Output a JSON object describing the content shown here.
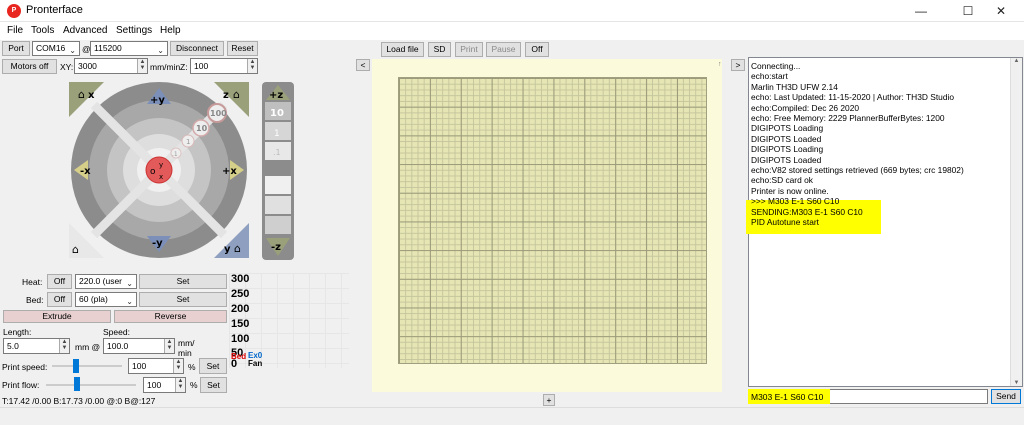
{
  "window": {
    "title": "Pronterface",
    "icon_text": "P",
    "minimize_glyph": "—",
    "maximize_glyph": "☐",
    "close_glyph": "✕"
  },
  "menu": [
    "File",
    "Tools",
    "Advanced",
    "Settings",
    "Help"
  ],
  "connection": {
    "port_label": "Port",
    "port_value": "COM16",
    "at": "@",
    "baud_value": "115200",
    "disconnect_label": "Disconnect",
    "reset_label": "Reset"
  },
  "motion": {
    "motors_off_label": "Motors off",
    "xy_label": "XY:",
    "xy_value": "3000",
    "xy_unit": "mm/min",
    "z_label": "Z:",
    "z_value": "100"
  },
  "jog": {
    "home_x": "x",
    "home_y": "y",
    "home_z": "z",
    "plus_y": "+y",
    "minus_y": "-y",
    "plus_x": "+x",
    "minus_x": "-x",
    "steps": [
      "100",
      "10",
      "1",
      ".1"
    ],
    "center_labels": [
      "o",
      "y",
      "x"
    ],
    "z_plus": "+z",
    "z_minus": "-z",
    "z_steps": [
      "10",
      "1",
      ".1"
    ]
  },
  "temperature": {
    "heat_label": "Heat:",
    "heat_off": "Off",
    "heat_value": "220.0 (user",
    "heat_set": "Set",
    "bed_label": "Bed:",
    "bed_off": "Off",
    "bed_value": "60 (pla)",
    "bed_set": "Set"
  },
  "graph": {
    "ticks": [
      "300",
      "250",
      "200",
      "150",
      "100",
      "50",
      "0"
    ],
    "legend_bed": "Bed",
    "legend_ex0": "Ex0",
    "legend_fan": "Fan"
  },
  "extrude": {
    "extrude_label": "Extrude",
    "reverse_label": "Reverse",
    "length_label": "Length:",
    "length_value": "5.0",
    "length_unit": "mm @",
    "speed_label": "Speed:",
    "speed_value": "100.0",
    "speed_unit_1": "mm/",
    "speed_unit_2": "min",
    "print_speed_label": "Print speed:",
    "print_speed_value": "100",
    "print_speed_pct": 0.34,
    "pct": "%",
    "print_speed_set": "Set",
    "print_flow_label": "Print flow:",
    "print_flow_value": "100",
    "print_flow_pct": 0.34,
    "print_flow_set": "Set"
  },
  "status": {
    "temps": "T:17.42 /0.00 B:17.73 /0.00 @:0 B@:127"
  },
  "toolbar": {
    "load_file": "Load file",
    "sd": "SD",
    "print": "Print",
    "pause": "Pause",
    "off": "Off"
  },
  "collapse_left": "<",
  "collapse_right": ">",
  "layer_up": "↑",
  "add_button": "+",
  "console": {
    "lines": [
      "Connecting...",
      "echo:start",
      "Marlin TH3D UFW 2.14",
      "echo: Last Updated: 11-15-2020 | Author: TH3D Studio",
      "echo:Compiled: Dec 26 2020",
      "echo: Free Memory: 2229  PlannerBufferBytes: 1200",
      "DIGIPOTS Loading",
      "DIGIPOTS Loaded",
      "DIGIPOTS Loading",
      "DIGIPOTS Loaded",
      "echo:V82 stored settings retrieved (669 bytes; crc 19802)",
      "echo:SD card ok",
      "Printer is now online.",
      ">>> M303 E-1 S60 C10",
      "SENDING:M303 E-1 S60 C10",
      "PID Autotune start"
    ],
    "command_value": "M303 E-1 S60 C10",
    "send_label": "Send",
    "highlight_color": "#ffff00"
  }
}
